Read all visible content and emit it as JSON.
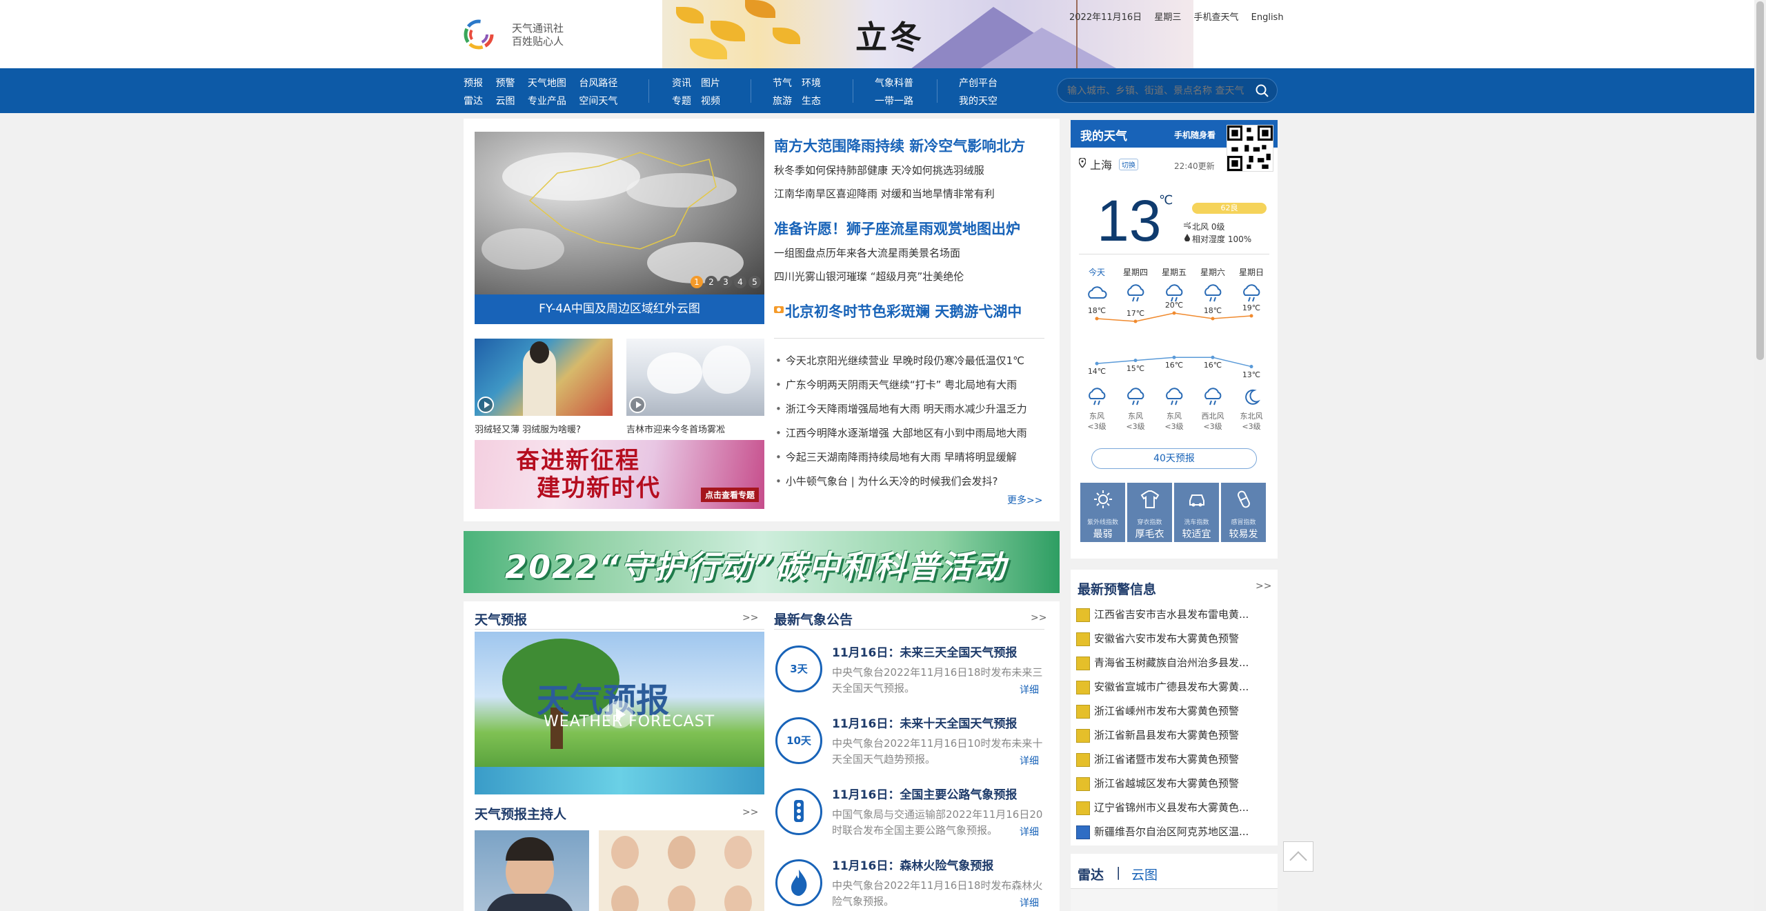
{
  "header": {
    "logo_line1": "天气通讯社",
    "logo_line2": "百姓贴心人",
    "banner_title": "立冬",
    "top_links": [
      "2022年11月16日",
      "星期三",
      "手机查天气",
      "English"
    ]
  },
  "nav": {
    "group1_row1": [
      "预报",
      "预警",
      "天气地图",
      "台风路径"
    ],
    "group1_row2": [
      "雷达",
      "云图",
      "专业产品",
      "空间天气"
    ],
    "group2_row1": [
      "资讯",
      "图片"
    ],
    "group2_row2": [
      "专题",
      "视频"
    ],
    "group3_row1": [
      "节气",
      "环境"
    ],
    "group3_row2": [
      "旅游",
      "生态"
    ],
    "group4_row1": [
      "气象科普"
    ],
    "group4_row2": [
      "一带一路"
    ],
    "group5_row1": [
      "产创平台"
    ],
    "group5_row2": [
      "我的天空"
    ],
    "search_placeholder": "输入城市、乡镇、街道、景点名称 查天气"
  },
  "featured": {
    "satellite_caption": "FY-4A中国及周边区域红外云图",
    "slide_dots": [
      "1",
      "2",
      "3",
      "4",
      "5"
    ],
    "headlines": [
      {
        "title": "南方大范围降雨持续 新冷空气影响北方",
        "subs": [
          "秋冬季如何保持肺部健康 天冷如何挑选羽绒服",
          "江南华南旱区喜迎降雨 对缓和当地旱情非常有利"
        ]
      },
      {
        "title": "准备许愿！狮子座流星雨观赏地图出炉",
        "subs": [
          "一组图盘点历年来各大流星雨美景名场面",
          "四川光雾山银河璀璨 “超级月亮”壮美绝伦"
        ]
      },
      {
        "title": "北京初冬时节色彩斑斓 天鹅游弋湖中",
        "subs": []
      }
    ],
    "thumbs": [
      {
        "caption": "羽绒轻又薄 羽绒服为啥暖?"
      },
      {
        "caption": "吉林市迎来今冬首场雾凇"
      }
    ],
    "promo_line1": "奋进新征程",
    "promo_line2": "建功新时代",
    "promo_btn": "点击查看专题",
    "news_list": [
      "今天北京阳光继续营业 早晚时段仍寒冷最低温仅1℃",
      "广东今明两天阴雨天气继续“打卡” 粤北局地有大雨",
      "浙江今天降雨增强局地有大雨 明天雨水减少升温乏力",
      "江西今明降水逐渐增强 大部地区有小到中雨局地大雨",
      "今起三天湖南降雨持续局地有大雨 早晴将明显缓解",
      "小牛顿气象台 | 为什么天冷的时候我们会发抖?"
    ],
    "more": "更多>>"
  },
  "carbon_banner": "2022“守护行动”碳中和科普活动",
  "forecast_section": {
    "title": "天气预报",
    "more": ">>",
    "video_title": "天气预报",
    "video_sub": "WEATHER FORECAST",
    "anchor_title": "天气预报主持人",
    "anchor_more": ">>"
  },
  "bulletins": {
    "title": "最新气象公告",
    "more": ">>",
    "items": [
      {
        "icon": "3天",
        "title": "11月16日：未来三天全国天气预报",
        "desc": "中央气象台2022年11月16日18时发布未来三天全国天气预报。",
        "more": "详细"
      },
      {
        "icon": "10天",
        "title": "11月16日：未来十天全国天气预报",
        "desc": "中央气象台2022年11月16日10时发布未来十天全国天气趋势预报。",
        "more": "详细"
      },
      {
        "icon": "",
        "title": "11月16日：全国主要公路气象预报",
        "desc": "中国气象局与交通运输部2022年11月16日20时联合发布全国主要公路气象预报。",
        "more": "详细"
      },
      {
        "icon": "",
        "title": "11月16日：森林火险气象预报",
        "desc": "中央气象台2022年11月16日18时发布森林火险气象预报。",
        "more": "详细"
      }
    ]
  },
  "my_weather": {
    "title": "我的天气",
    "mobile": "手机随身看",
    "city": "上海",
    "switch": "切换",
    "updated": "22:40更新",
    "temp": "13",
    "unit": "℃",
    "aqi": "62良",
    "wind": "北风 0级",
    "humidity": "相对湿度 100%",
    "days": [
      "今天",
      "星期四",
      "星期五",
      "星期六",
      "星期日"
    ],
    "icons": [
      "cloudy-icon",
      "rain-icon",
      "rain-icon",
      "rain-icon",
      "rain-icon"
    ],
    "night_icons": [
      "rain-icon",
      "rain-icon",
      "rain-icon",
      "rain-icon",
      "moon-icon"
    ],
    "highs": [
      "18℃",
      "17℃",
      "20℃",
      "18℃",
      "19℃"
    ],
    "lows": [
      "14℃",
      "15℃",
      "16℃",
      "16℃",
      "13℃"
    ],
    "winds": [
      [
        "东风",
        "<3级"
      ],
      [
        "东风",
        "<3级"
      ],
      [
        "东风",
        "<3级"
      ],
      [
        "西北风",
        "<3级"
      ],
      [
        "东北风",
        "<3级"
      ]
    ],
    "forecast40": "40天预报",
    "indices": [
      {
        "name": "紫外线指数",
        "value": "最弱"
      },
      {
        "name": "穿衣指数",
        "value": "厚毛衣"
      },
      {
        "name": "洗车指数",
        "value": "较适宜"
      },
      {
        "name": "感冒指数",
        "value": "较易发"
      }
    ]
  },
  "warnings": {
    "title": "最新预警信息",
    "more": ">>",
    "items": [
      "江西省吉安市吉水县发布雷电黄...",
      "安徽省六安市发布大雾黄色预警",
      "青海省玉树藏族自治州治多县发...",
      "安徽省宣城市广德县发布大雾黄...",
      "浙江省嵊州市发布大雾黄色预警",
      "浙江省新昌县发布大雾黄色预警",
      "浙江省诸暨市发布大雾黄色预警",
      "浙江省越城区发布大雾黄色预警",
      "辽宁省锦州市义县发布大雾黄色...",
      "新疆维吾尔自治区阿克苏地区温..."
    ]
  },
  "radar": {
    "tab1": "雷达",
    "sep": "|",
    "tab2": "云图"
  },
  "colors": {
    "brand_blue": "#0d5aa7",
    "link_blue": "#1863b8",
    "dark_blue": "#1e3b6a",
    "warning_yellow": "#e5bf2a"
  }
}
